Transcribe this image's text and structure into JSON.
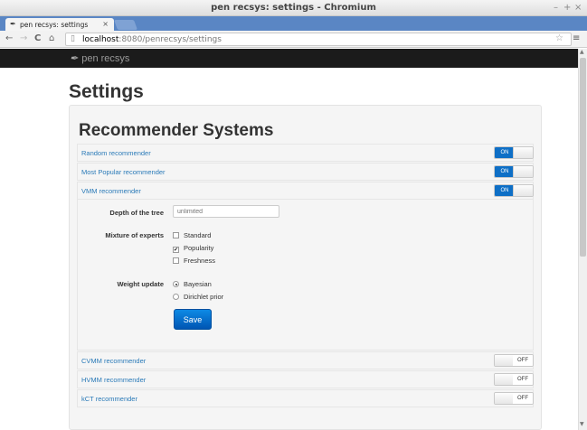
{
  "window": {
    "title": "pen recsys: settings - Chromium",
    "controls": [
      "–",
      "+",
      "×"
    ]
  },
  "tab": {
    "label": "pen recsys: settings",
    "close": "×"
  },
  "toolbar": {
    "back": "←",
    "forward": "→",
    "reload": "C",
    "home": "⌂",
    "url_host": "localhost",
    "url_rest": ":8080/penrecsys/settings",
    "star": "☆",
    "menu": "≡"
  },
  "navbar": {
    "brand": "pen recsys"
  },
  "page": {
    "title": "Settings",
    "section_title": "Recommender Systems"
  },
  "recommenders": [
    {
      "name": "Random recommender",
      "state": "ON"
    },
    {
      "name": "Most Popular recommender",
      "state": "ON"
    },
    {
      "name": "VMM recommender",
      "state": "ON"
    },
    {
      "name": "CVMM recommender",
      "state": "OFF"
    },
    {
      "name": "HVMM recommender",
      "state": "OFF"
    },
    {
      "name": "kCT recommender",
      "state": "OFF"
    }
  ],
  "vmm_form": {
    "depth_label": "Depth of the tree",
    "depth_placeholder": "unlimited",
    "mixture_label": "Mixture of experts",
    "experts": [
      {
        "label": "Standard",
        "checked": false
      },
      {
        "label": "Popularity",
        "checked": true
      },
      {
        "label": "Freshness",
        "checked": false
      }
    ],
    "weight_label": "Weight update",
    "weights": [
      {
        "label": "Bayesian",
        "checked": true
      },
      {
        "label": "Dirichlet prior",
        "checked": false
      }
    ],
    "save_label": "Save"
  },
  "colors": {
    "accent": "#0e6fc6",
    "link": "#2a7ab8",
    "navbar": "#1b1b1b",
    "tabstrip": "#5a86c4"
  }
}
